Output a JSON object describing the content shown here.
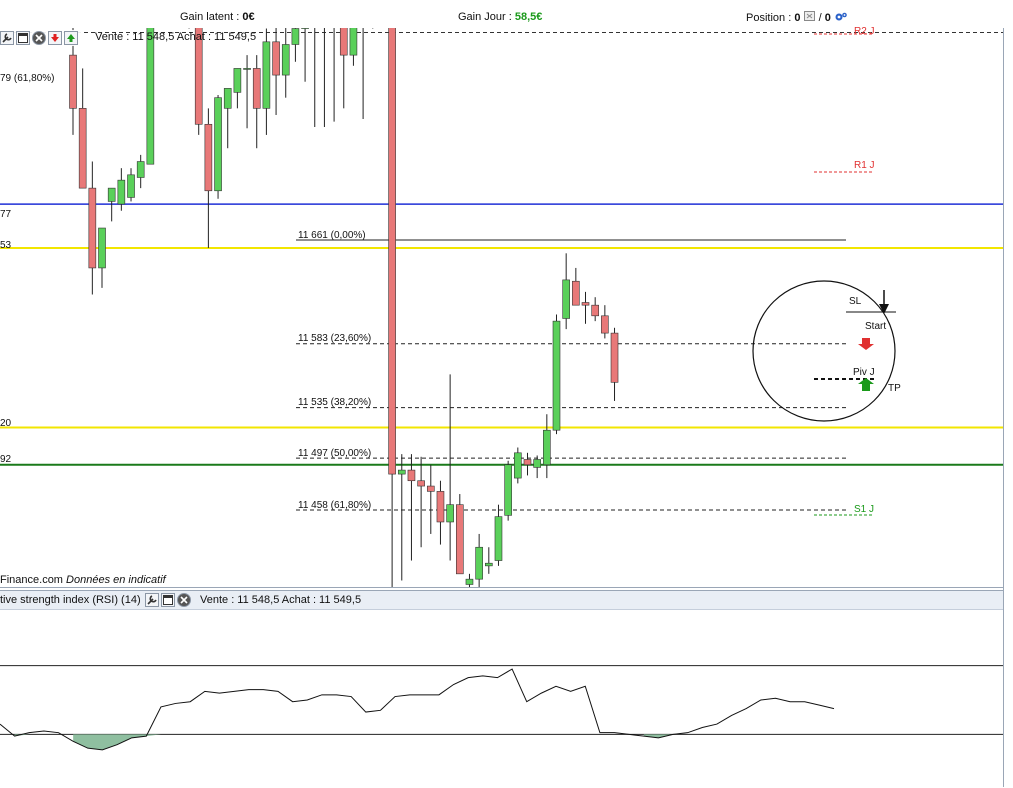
{
  "header": {
    "gain_latent_label": "Gain latent : ",
    "gain_latent_value": "0€",
    "gain_jour_label": "Gain Jour : ",
    "gain_jour_value": "58,5€",
    "position_label": "Position : ",
    "position_value_a": "0",
    "position_sep": "/",
    "position_value_b": "0"
  },
  "chart_toolbar": {
    "quote": "Vente : 11 548,5 Achat : 11 549,5"
  },
  "watermark": {
    "brand": "Finance.com",
    "note": "Données en indicatif"
  },
  "edge_labels": [
    "79 (61,80%)",
    "77",
    "53",
    "20",
    "92"
  ],
  "pivot_labels": {
    "r1": "R1 J",
    "s1": "S1 J",
    "r2_partial": "R2 J"
  },
  "annotations": {
    "sl": "SL",
    "start": "Start",
    "piv": "Piv J",
    "tp": "TP"
  },
  "colors": {
    "bull": "#5ad05a",
    "bear": "#e87878",
    "blue_line": "#1f2fd6",
    "yellow_line": "#f2e600",
    "green_line": "#1a7a1a",
    "pivot_red": "#e03030",
    "pivot_green": "#1a9a1a",
    "rsi_fill": "#8fbfa0"
  },
  "rsi": {
    "title": "tive strength index (RSI) (14)",
    "quote": "Vente : 11 548,5 Achat : 11 549,5",
    "upper": 70,
    "lower": 30
  },
  "chart_data": {
    "type": "candlestick",
    "fib_levels": [
      {
        "price": 11661,
        "label": "11 661 (0,00%)"
      },
      {
        "price": 11583,
        "label": "11 583 (23,60%)"
      },
      {
        "price": 11535,
        "label": "11 535 (38,20%)"
      },
      {
        "price": 11497,
        "label": "11 497 (50,00%)"
      },
      {
        "price": 11458,
        "label": "11 458 (61,80%)"
      }
    ],
    "y_range": [
      11400,
      11855
    ],
    "candles": [
      {
        "o": 11800,
        "h": 11830,
        "l": 11740,
        "c": 11760
      },
      {
        "o": 11760,
        "h": 11790,
        "l": 11700,
        "c": 11700
      },
      {
        "o": 11700,
        "h": 11720,
        "l": 11620,
        "c": 11640
      },
      {
        "o": 11640,
        "h": 11670,
        "l": 11625,
        "c": 11670
      },
      {
        "o": 11690,
        "h": 11700,
        "l": 11675,
        "c": 11700
      },
      {
        "o": 11688,
        "h": 11715,
        "l": 11683,
        "c": 11706
      },
      {
        "o": 11693,
        "h": 11715,
        "l": 11690,
        "c": 11710
      },
      {
        "o": 11708,
        "h": 11725,
        "l": 11700,
        "c": 11720
      },
      {
        "o": 11718,
        "h": 11840,
        "l": 11718,
        "c": 11840
      },
      {
        "o": 11843,
        "h": 11850,
        "l": 11838,
        "c": 11848
      },
      {
        "o": 11845,
        "h": 11850,
        "l": 11840,
        "c": 11848
      },
      {
        "o": 11848,
        "h": 11852,
        "l": 11842,
        "c": 11846
      },
      {
        "o": 11846,
        "h": 11850,
        "l": 11820,
        "c": 11846
      },
      {
        "o": 11846,
        "h": 11850,
        "l": 11740,
        "c": 11748
      },
      {
        "o": 11748,
        "h": 11760,
        "l": 11655,
        "c": 11698
      },
      {
        "o": 11698,
        "h": 11770,
        "l": 11692,
        "c": 11768
      },
      {
        "o": 11760,
        "h": 11772,
        "l": 11730,
        "c": 11775
      },
      {
        "o": 11772,
        "h": 11790,
        "l": 11760,
        "c": 11790
      },
      {
        "o": 11790,
        "h": 11800,
        "l": 11745,
        "c": 11790
      },
      {
        "o": 11790,
        "h": 11800,
        "l": 11730,
        "c": 11760
      },
      {
        "o": 11760,
        "h": 11820,
        "l": 11740,
        "c": 11810
      },
      {
        "o": 11810,
        "h": 11840,
        "l": 11755,
        "c": 11785
      },
      {
        "o": 11785,
        "h": 11822,
        "l": 11768,
        "c": 11808
      },
      {
        "o": 11808,
        "h": 11830,
        "l": 11795,
        "c": 11820
      },
      {
        "o": 11820,
        "h": 11850,
        "l": 11780,
        "c": 11848
      },
      {
        "o": 11848,
        "h": 11852,
        "l": 11746,
        "c": 11850
      },
      {
        "o": 11850,
        "h": 11852,
        "l": 11746,
        "c": 11850
      },
      {
        "o": 11850,
        "h": 11852,
        "l": 11750,
        "c": 11850
      },
      {
        "o": 11845,
        "h": 11850,
        "l": 11760,
        "c": 11800
      },
      {
        "o": 11800,
        "h": 11848,
        "l": 11792,
        "c": 11842
      },
      {
        "o": 11842,
        "h": 11850,
        "l": 11752,
        "c": 11830
      },
      {
        "o": 11830,
        "h": 11852,
        "l": 11820,
        "c": 11852
      },
      {
        "o": 11852,
        "h": 11855,
        "l": 11830,
        "c": 11840
      },
      {
        "o": 11836,
        "h": 11840,
        "l": 11400,
        "c": 11485
      },
      {
        "o": 11485,
        "h": 11500,
        "l": 11405,
        "c": 11488
      },
      {
        "o": 11488,
        "h": 11500,
        "l": 11420,
        "c": 11480
      },
      {
        "o": 11480,
        "h": 11498,
        "l": 11430,
        "c": 11476
      },
      {
        "o": 11476,
        "h": 11492,
        "l": 11440,
        "c": 11472
      },
      {
        "o": 11472,
        "h": 11480,
        "l": 11432,
        "c": 11449
      },
      {
        "o": 11449,
        "h": 11560,
        "l": 11420,
        "c": 11462
      },
      {
        "o": 11462,
        "h": 11470,
        "l": 11410,
        "c": 11410
      },
      {
        "o": 11402,
        "h": 11410,
        "l": 11400,
        "c": 11406
      },
      {
        "o": 11406,
        "h": 11440,
        "l": 11400,
        "c": 11430
      },
      {
        "o": 11416,
        "h": 11430,
        "l": 11410,
        "c": 11418
      },
      {
        "o": 11420,
        "h": 11462,
        "l": 11416,
        "c": 11453
      },
      {
        "o": 11454,
        "h": 11495,
        "l": 11450,
        "c": 11492
      },
      {
        "o": 11482,
        "h": 11505,
        "l": 11478,
        "c": 11501
      },
      {
        "o": 11496,
        "h": 11501,
        "l": 11484,
        "c": 11492
      },
      {
        "o": 11490,
        "h": 11499,
        "l": 11482,
        "c": 11496
      },
      {
        "o": 11492,
        "h": 11530,
        "l": 11482,
        "c": 11518
      },
      {
        "o": 11518,
        "h": 11605,
        "l": 11515,
        "c": 11600
      },
      {
        "o": 11602,
        "h": 11651,
        "l": 11594,
        "c": 11631
      },
      {
        "o": 11630,
        "h": 11640,
        "l": 11612,
        "c": 11612
      },
      {
        "o": 11614,
        "h": 11622,
        "l": 11598,
        "c": 11612
      },
      {
        "o": 11612,
        "h": 11618,
        "l": 11600,
        "c": 11604
      },
      {
        "o": 11604,
        "h": 11612,
        "l": 11587,
        "c": 11591
      },
      {
        "o": 11591,
        "h": 11595,
        "l": 11540,
        "c": 11554
      }
    ],
    "rsi_values": [
      36,
      29,
      31,
      32,
      31,
      26,
      22,
      21,
      24,
      28,
      29,
      46,
      48,
      49,
      55,
      54,
      55,
      56,
      56,
      55,
      49,
      50,
      53,
      53,
      52,
      43,
      44,
      52,
      53,
      53,
      53,
      59,
      63,
      64,
      63,
      68,
      49,
      54,
      58,
      55,
      58,
      31,
      31,
      30,
      29,
      28,
      30,
      31,
      34,
      36,
      41,
      45,
      50,
      51,
      49,
      49,
      47,
      45
    ],
    "rsi_range": [
      0,
      100
    ]
  }
}
